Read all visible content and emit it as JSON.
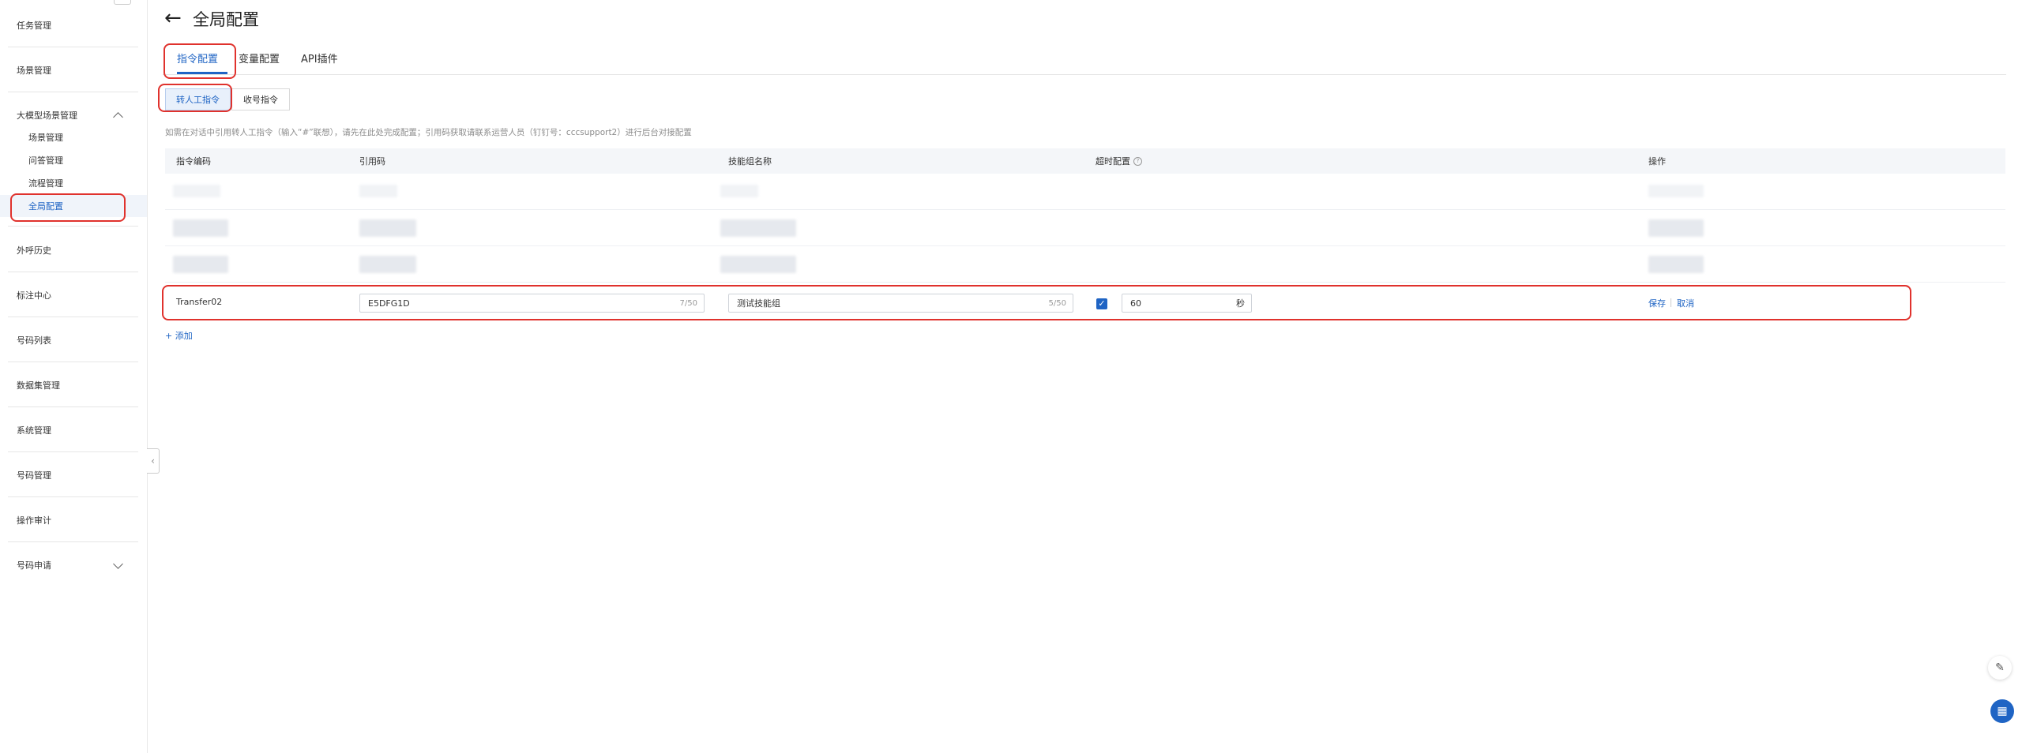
{
  "sidebar": {
    "items": [
      {
        "label": "任务管理"
      },
      {
        "label": "场景管理"
      },
      {
        "label": "大模型场景管理"
      },
      {
        "label": "外呼历史"
      },
      {
        "label": "标注中心"
      },
      {
        "label": "号码列表"
      },
      {
        "label": "数据集管理"
      },
      {
        "label": "系统管理"
      },
      {
        "label": "号码管理"
      },
      {
        "label": "操作审计"
      },
      {
        "label": "号码申请"
      }
    ],
    "sub_items": [
      {
        "label": "场景管理"
      },
      {
        "label": "问答管理"
      },
      {
        "label": "流程管理"
      },
      {
        "label": "全局配置"
      }
    ]
  },
  "header": {
    "title": "全局配置",
    "back_icon": "arrow-left-icon"
  },
  "tabs": [
    {
      "label": "指令配置"
    },
    {
      "label": "变量配置"
    },
    {
      "label": "API插件"
    }
  ],
  "segments": [
    {
      "label": "转人工指令"
    },
    {
      "label": "收号指令"
    }
  ],
  "hint": "如需在对话中引用转人工指令（输入“#”联想），请先在此处完成配置；引用码获取请联系运营人员（钉钉号：cccsupport2）进行后台对接配置",
  "table": {
    "columns": [
      "指令编码",
      "引用码",
      "技能组名称",
      "超时配置",
      "操作"
    ],
    "edit_row": {
      "code": "Transfer02",
      "ref_code": "E5DFG1D",
      "ref_count": "7/50",
      "skill_group": "测试技能组",
      "skill_count": "5/50",
      "timeout_enabled": true,
      "timeout_value": "60",
      "timeout_unit": "秒",
      "save": "保存",
      "cancel": "取消"
    }
  },
  "add_label": "+ 添加",
  "colors": {
    "primary": "#1f64c4",
    "highlight": "#e0322d"
  }
}
